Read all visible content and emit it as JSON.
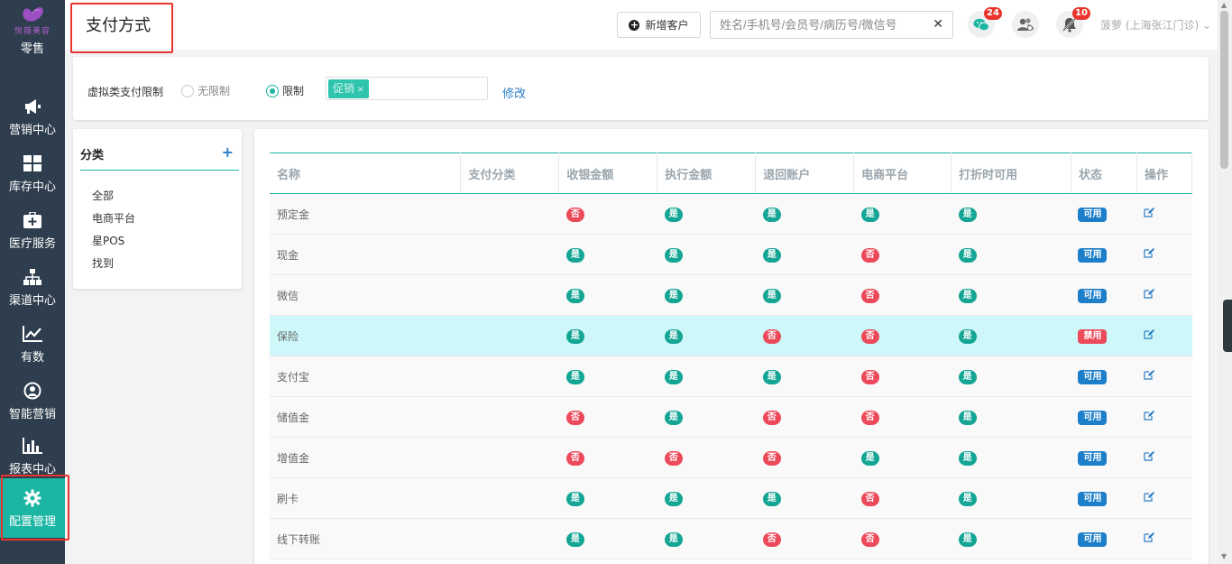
{
  "brand": {
    "logo_text": "悦薇美容",
    "colors": {
      "sidebar": "#2e3e4e",
      "accent": "#1bb5a3",
      "danger": "#ec4a5a",
      "primary": "#1d7fc9"
    }
  },
  "sidebar": {
    "first_label": "零售",
    "items": [
      {
        "label": "营销中心",
        "icon": "megaphone-icon"
      },
      {
        "label": "库存中心",
        "icon": "grid-icon"
      },
      {
        "label": "医疗服务",
        "icon": "medical-kit-icon"
      },
      {
        "label": "渠道中心",
        "icon": "sitemap-icon"
      },
      {
        "label": "有数",
        "icon": "line-chart-icon"
      },
      {
        "label": "智能营销",
        "icon": "people-icon"
      },
      {
        "label": "报表中心",
        "icon": "bar-chart-icon"
      },
      {
        "label": "配置管理",
        "icon": "gear-icon",
        "active": true
      }
    ]
  },
  "header": {
    "title": "支付方式",
    "new_customer": "新增客户",
    "search_placeholder": "姓名/手机号/会员号/病历号/微信号",
    "wechat_badge": "24",
    "bell_badge": "10",
    "user": "菠萝 (上海张江门诊)"
  },
  "filter": {
    "label": "虚拟类支付限制",
    "option_none": "无限制",
    "option_limit": "限制",
    "selected": "限制",
    "tag": "促销",
    "modify": "修改"
  },
  "category": {
    "title": "分类",
    "items": [
      "全部",
      "电商平台",
      "星POS",
      "找到"
    ]
  },
  "table": {
    "headers": [
      "名称",
      "支付分类",
      "收银金额",
      "执行金额",
      "退回账户",
      "电商平台",
      "打折时可用",
      "状态",
      "操作"
    ],
    "yes_label": "是",
    "no_label": "否",
    "rows": [
      {
        "name": "预定金",
        "category": "",
        "flags": [
          false,
          true,
          true,
          true,
          true
        ],
        "status": "可用"
      },
      {
        "name": "现金",
        "category": "",
        "flags": [
          true,
          true,
          true,
          false,
          true
        ],
        "status": "可用"
      },
      {
        "name": "微信",
        "category": "",
        "flags": [
          true,
          true,
          true,
          false,
          true
        ],
        "status": "可用"
      },
      {
        "name": "保险",
        "category": "",
        "flags": [
          true,
          true,
          false,
          false,
          true
        ],
        "status": "禁用"
      },
      {
        "name": "支付宝",
        "category": "",
        "flags": [
          true,
          true,
          true,
          false,
          true
        ],
        "status": "可用"
      },
      {
        "name": "储值金",
        "category": "",
        "flags": [
          false,
          true,
          false,
          false,
          true
        ],
        "status": "可用"
      },
      {
        "name": "增值金",
        "category": "",
        "flags": [
          false,
          false,
          false,
          true,
          true
        ],
        "status": "可用"
      },
      {
        "name": "刷卡",
        "category": "",
        "flags": [
          true,
          true,
          true,
          false,
          true
        ],
        "status": "可用"
      },
      {
        "name": "线下转账",
        "category": "",
        "flags": [
          true,
          true,
          false,
          false,
          true
        ],
        "status": "可用"
      }
    ]
  }
}
